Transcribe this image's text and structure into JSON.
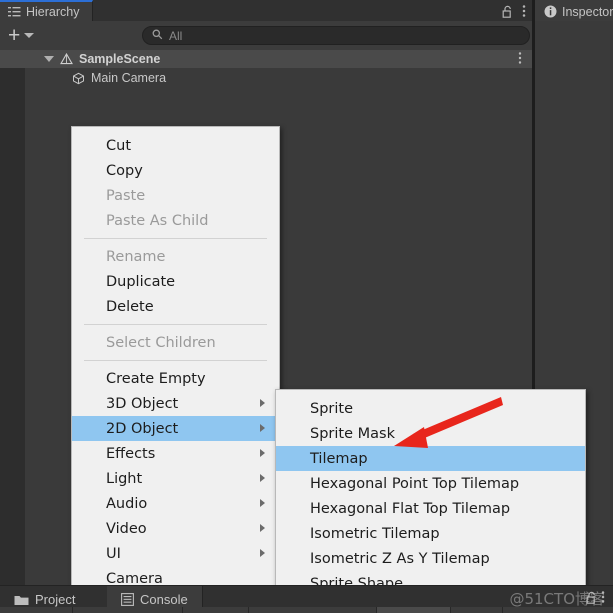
{
  "window": {
    "hierarchy_tab": "Hierarchy",
    "inspector_tab": "Inspector",
    "hierarchy_icon": "hierarchy-list-icon",
    "inspector_icon": "info-circle-icon",
    "lock_icon": "lock-open-icon",
    "kebab_icon": "kebab-menu-icon"
  },
  "hierarchy": {
    "add_button_label": "+",
    "add_dropdown_icon": "chevron-down-icon",
    "search": {
      "placeholder": "All",
      "value": "",
      "icon": "search-icon"
    },
    "rows": [
      {
        "label": "SampleScene",
        "icon": "unity-scene-icon",
        "expanded": true,
        "selected": true,
        "depth": 0
      },
      {
        "label": "Main Camera",
        "icon": "gameobject-cube-icon",
        "expanded": false,
        "selected": false,
        "depth": 1
      }
    ]
  },
  "context_menu": {
    "items": [
      {
        "label": "Cut",
        "enabled": true,
        "submenu": false,
        "highlighted": false
      },
      {
        "label": "Copy",
        "enabled": true,
        "submenu": false,
        "highlighted": false
      },
      {
        "label": "Paste",
        "enabled": false,
        "submenu": false,
        "highlighted": false
      },
      {
        "label": "Paste As Child",
        "enabled": false,
        "submenu": false,
        "highlighted": false
      },
      {
        "separator": true
      },
      {
        "label": "Rename",
        "enabled": false,
        "submenu": false,
        "highlighted": false
      },
      {
        "label": "Duplicate",
        "enabled": true,
        "submenu": false,
        "highlighted": false
      },
      {
        "label": "Delete",
        "enabled": true,
        "submenu": false,
        "highlighted": false
      },
      {
        "separator": true
      },
      {
        "label": "Select Children",
        "enabled": false,
        "submenu": false,
        "highlighted": false
      },
      {
        "separator": true
      },
      {
        "label": "Create Empty",
        "enabled": true,
        "submenu": false,
        "highlighted": false
      },
      {
        "label": "3D Object",
        "enabled": true,
        "submenu": true,
        "highlighted": false
      },
      {
        "label": "2D Object",
        "enabled": true,
        "submenu": true,
        "highlighted": true
      },
      {
        "label": "Effects",
        "enabled": true,
        "submenu": true,
        "highlighted": false
      },
      {
        "label": "Light",
        "enabled": true,
        "submenu": true,
        "highlighted": false
      },
      {
        "label": "Audio",
        "enabled": true,
        "submenu": true,
        "highlighted": false
      },
      {
        "label": "Video",
        "enabled": true,
        "submenu": true,
        "highlighted": false
      },
      {
        "label": "UI",
        "enabled": true,
        "submenu": true,
        "highlighted": false
      },
      {
        "label": "Camera",
        "enabled": true,
        "submenu": false,
        "highlighted": false
      }
    ]
  },
  "submenu": {
    "parent": "2D Object",
    "items": [
      {
        "label": "Sprite",
        "highlighted": false
      },
      {
        "label": "Sprite Mask",
        "highlighted": false
      },
      {
        "label": "Tilemap",
        "highlighted": true
      },
      {
        "label": "Hexagonal Point Top Tilemap",
        "highlighted": false
      },
      {
        "label": "Hexagonal Flat Top Tilemap",
        "highlighted": false
      },
      {
        "label": "Isometric Tilemap",
        "highlighted": false
      },
      {
        "label": "Isometric Z As Y Tilemap",
        "highlighted": false
      },
      {
        "label": "Sprite Shape",
        "highlighted": false
      }
    ]
  },
  "bottom_bar": {
    "tabs": [
      {
        "label": "Project",
        "icon": "folder-icon",
        "active": false
      },
      {
        "label": "Console",
        "icon": "console-icon",
        "active": true
      }
    ],
    "lock_icon": "lock-open-icon",
    "kebab_icon": "kebab-menu-icon"
  },
  "annotation": {
    "type": "red-arrow",
    "points_to": "Tilemap",
    "color": "#e8261c"
  },
  "watermark": {
    "text": "@51CTO博客"
  },
  "colors": {
    "editor_bg": "#282828",
    "panel_bg": "#3a3a3a",
    "tab_active_bg": "#3c3c3c",
    "tab_accent": "#2c6fd6",
    "menu_bg": "#f0f0f0",
    "menu_highlight": "#8fc6f0",
    "menu_text": "#1d1d1d",
    "menu_text_disabled": "#9a9a9a",
    "arrow_red": "#e8261c"
  }
}
